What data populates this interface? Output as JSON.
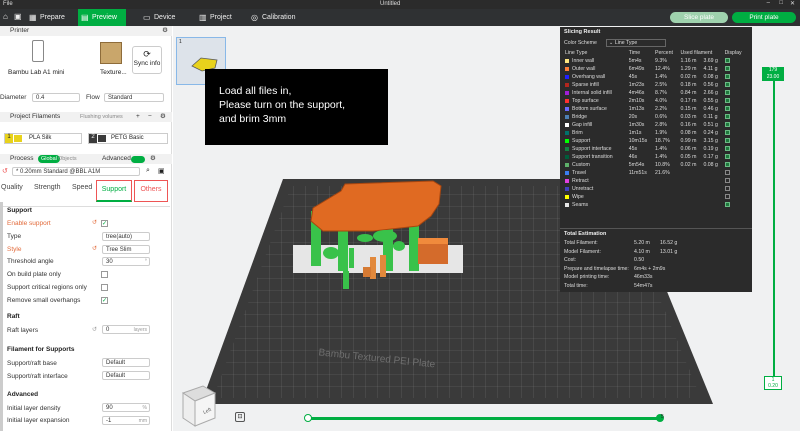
{
  "titlebar": {
    "menu": "File",
    "title": "Untitled"
  },
  "topbar": {
    "tabs": [
      "Prepare",
      "Preview",
      "Device",
      "Project",
      "Calibration"
    ],
    "active": 1,
    "slice_btn": "Slice plate",
    "print_btn": "Print plate"
  },
  "sidebar": {
    "printer": {
      "header": "Printer",
      "name": "Bambu Lab A1 mini",
      "plate": "Texture...",
      "sync": "Sync info",
      "diameter_label": "Diameter",
      "diameter": "0.4",
      "flow_label": "Flow",
      "flow": "Standard"
    },
    "filaments": {
      "header": "Project Filaments",
      "flushing": "Flushing volumes",
      "items": [
        {
          "num": "1",
          "name": "PLA Silk",
          "color": "#e8d21c"
        },
        {
          "num": "2",
          "name": "PETG Basic",
          "color": "#3b3b3b"
        }
      ]
    },
    "process": {
      "header": "Process",
      "global": "Global",
      "objects": "Objects",
      "advanced": "Advanced",
      "preset": "* 0.20mm Standard @BBL A1M"
    },
    "tabs": [
      "Quality",
      "Strength",
      "Speed",
      "Support",
      "Others"
    ],
    "support": {
      "header": "Support",
      "rows": [
        {
          "label": "Enable support",
          "type": "check",
          "value": "✓",
          "modified": true
        },
        {
          "label": "Type",
          "type": "select",
          "value": "tree(auto)"
        },
        {
          "label": "Style",
          "type": "select",
          "value": "Tree Slim",
          "modified": true
        },
        {
          "label": "Threshold angle",
          "type": "num",
          "value": "30",
          "unit": "°"
        },
        {
          "label": "On build plate only",
          "type": "check",
          "value": ""
        },
        {
          "label": "Support critical regions only",
          "type": "check",
          "value": ""
        },
        {
          "label": "Remove small overhangs",
          "type": "check",
          "value": "✓"
        }
      ]
    },
    "raft": {
      "header": "Raft",
      "layers_label": "Raft layers",
      "layers": "0",
      "unit": "layers"
    },
    "filament_support": {
      "header": "Filament for Supports",
      "base_label": "Support/raft base",
      "base": "Default",
      "iface_label": "Support/raft interface",
      "iface": "Default"
    },
    "advanced": {
      "header": "Advanced",
      "density_label": "Initial layer density",
      "density": "90",
      "density_unit": "%",
      "expansion_label": "Initial layer expansion",
      "expansion": "-1",
      "expansion_unit": "mm"
    }
  },
  "canvas": {
    "plate_num": "1",
    "plate_label": "Bambu Textured PEI Plate",
    "layer_top": "179",
    "layer_top_h": "23.00",
    "layer_bot": "1",
    "layer_bot_h": "0.20",
    "slider_val": "5",
    "cube_label": "Left"
  },
  "note": {
    "lines": [
      "Load all files in,",
      "Please turn on the support,",
      "and brim 3mm"
    ]
  },
  "slicing": {
    "title": "Slicing Result",
    "scheme_label": "Color Scheme",
    "scheme": "Line Type",
    "columns": [
      "Line Type",
      "Time",
      "Percent",
      "Used filament",
      "Display"
    ],
    "rows": [
      {
        "name": "Inner wall",
        "color": "#ffe680",
        "time": "5m4s",
        "pct": "9.3%",
        "m": "1.16 m",
        "g": "3.69 g",
        "chk": true
      },
      {
        "name": "Outer wall",
        "color": "#ff7d38",
        "time": "6m49s",
        "pct": "12.4%",
        "m": "1.29 m",
        "g": "4.11 g",
        "chk": true
      },
      {
        "name": "Overhang wall",
        "color": "#2020ff",
        "time": "45s",
        "pct": "1.4%",
        "m": "0.02 m",
        "g": "0.08 g",
        "chk": true
      },
      {
        "name": "Sparse infill",
        "color": "#b3261e",
        "time": "1m23s",
        "pct": "2.5%",
        "m": "0.18 m",
        "g": "0.56 g",
        "chk": true
      },
      {
        "name": "Internal solid infill",
        "color": "#a01fd6",
        "time": "4m46s",
        "pct": "8.7%",
        "m": "0.84 m",
        "g": "2.66 g",
        "chk": true
      },
      {
        "name": "Top surface",
        "color": "#ff3030",
        "time": "2m10s",
        "pct": "4.0%",
        "m": "0.17 m",
        "g": "0.55 g",
        "chk": true
      },
      {
        "name": "Bottom surface",
        "color": "#6a6aff",
        "time": "1m13s",
        "pct": "2.2%",
        "m": "0.15 m",
        "g": "0.46 g",
        "chk": true
      },
      {
        "name": "Bridge",
        "color": "#4d80b3",
        "time": "20s",
        "pct": "0.6%",
        "m": "0.03 m",
        "g": "0.11 g",
        "chk": true
      },
      {
        "name": "Gap infill",
        "color": "#ffffff",
        "time": "1m30s",
        "pct": "2.8%",
        "m": "0.16 m",
        "g": "0.51 g",
        "chk": true
      },
      {
        "name": "Brim",
        "color": "#00716b",
        "time": "1m1s",
        "pct": "1.9%",
        "m": "0.08 m",
        "g": "0.24 g",
        "chk": true
      },
      {
        "name": "Support",
        "color": "#00ff00",
        "time": "10m15s",
        "pct": "18.7%",
        "m": "0.99 m",
        "g": "3.15 g",
        "chk": true
      },
      {
        "name": "Support interface",
        "color": "#138042",
        "time": "45s",
        "pct": "1.4%",
        "m": "0.06 m",
        "g": "0.19 g",
        "chk": true
      },
      {
        "name": "Support transition",
        "color": "#005c3b",
        "time": "46s",
        "pct": "1.4%",
        "m": "0.05 m",
        "g": "0.17 g",
        "chk": true
      },
      {
        "name": "Custom",
        "color": "#5eb06a",
        "time": "5m54s",
        "pct": "10.8%",
        "m": "0.02 m",
        "g": "0.08 g",
        "chk": true
      },
      {
        "name": "Travel",
        "color": "#3b7ef0",
        "time": "11m51s",
        "pct": "21.6%",
        "m": "",
        "g": "",
        "chk": false
      },
      {
        "name": "Retract",
        "color": "#e040e0",
        "time": "",
        "pct": "",
        "m": "",
        "g": "",
        "chk": false
      },
      {
        "name": "Unretract",
        "color": "#4040c0",
        "time": "",
        "pct": "",
        "m": "",
        "g": "",
        "chk": false
      },
      {
        "name": "Wipe",
        "color": "#ffff00",
        "time": "",
        "pct": "",
        "m": "",
        "g": "",
        "chk": false
      },
      {
        "name": "Seams",
        "color": "#e6e6e6",
        "time": "",
        "pct": "",
        "m": "",
        "g": "",
        "chk": true
      }
    ],
    "total_header": "Total Estimation",
    "totals": [
      {
        "label": "Total Filament:",
        "a": "5.20 m",
        "b": "16.52 g"
      },
      {
        "label": "Model Filament:",
        "a": "4.10 m",
        "b": "13.01 g"
      },
      {
        "label": "Cost:",
        "a": "0.50",
        "b": ""
      },
      {
        "label": "Prepare and timelapse time:",
        "a": "6m4s + 2m9s",
        "b": ""
      },
      {
        "label": "Model printing time:",
        "a": "46m33s",
        "b": ""
      },
      {
        "label": "Total time:",
        "a": "54m47s",
        "b": ""
      }
    ]
  }
}
